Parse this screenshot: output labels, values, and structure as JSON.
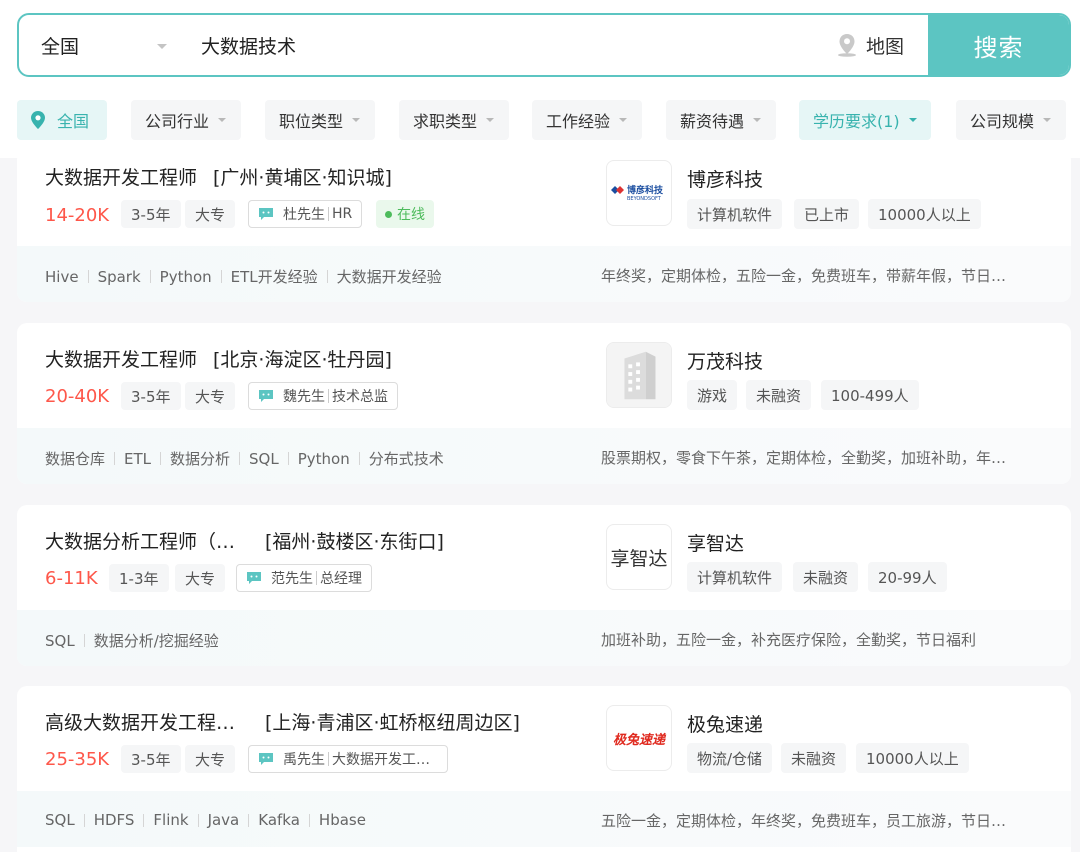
{
  "search": {
    "city": "全国",
    "query": "大数据技术",
    "map_label": "地图",
    "button_label": "搜索"
  },
  "filters": [
    {
      "label": "全国"
    },
    {
      "label": "公司行业"
    },
    {
      "label": "职位类型"
    },
    {
      "label": "求职类型"
    },
    {
      "label": "工作经验"
    },
    {
      "label": "薪资待遇"
    },
    {
      "label": "学历要求(1)"
    },
    {
      "label": "公司规模"
    }
  ],
  "colors": {
    "accent": "#5cc5c2",
    "salary": "#fe574a",
    "online": "#4dbb5c"
  },
  "jobs": [
    {
      "title": "大数据开发工程师",
      "location": "[广州·黄埔区·知识城]",
      "salary": "14-20K",
      "experience": "3-5年",
      "education": "大专",
      "recruiter_name": "杜先生",
      "recruiter_title": "HR",
      "online": "在线",
      "company": "博彦科技",
      "company_tags": [
        "计算机软件",
        "已上市",
        "10000人以上"
      ],
      "skills": [
        "Hive",
        "Spark",
        "Python",
        "ETL开发经验",
        "大数据开发经验"
      ],
      "welfare": "年终奖，定期体检，五险一金，免费班车，带薪年假，节日…",
      "logo_text": "博彦科技",
      "logo_sub": "BEYONDSOFT"
    },
    {
      "title": "大数据开发工程师",
      "location": "[北京·海淀区·牡丹园]",
      "salary": "20-40K",
      "experience": "3-5年",
      "education": "大专",
      "recruiter_name": "魏先生",
      "recruiter_title": "技术总监",
      "company": "万茂科技",
      "company_tags": [
        "游戏",
        "未融资",
        "100-499人"
      ],
      "skills": [
        "数据仓库",
        "ETL",
        "数据分析",
        "SQL",
        "Python",
        "分布式技术"
      ],
      "welfare": "股票期权，零食下午茶，定期体检，全勤奖，加班补助，年…"
    },
    {
      "title": "大数据分析工程师（…",
      "location": "[福州·鼓楼区·东街口]",
      "salary": "6-11K",
      "experience": "1-3年",
      "education": "大专",
      "recruiter_name": "范先生",
      "recruiter_title": "总经理",
      "company": "享智达",
      "company_tags": [
        "计算机软件",
        "未融资",
        "20-99人"
      ],
      "skills": [
        "SQL",
        "数据分析/挖掘经验"
      ],
      "welfare": "加班补助，五险一金，补充医疗保险，全勤奖，节日福利",
      "logo_text": "享智达"
    },
    {
      "title": "高级大数据开发工程…",
      "location": "[上海·青浦区·虹桥枢纽周边区]",
      "salary": "25-35K",
      "experience": "3-5年",
      "education": "大专",
      "recruiter_name": "禹先生",
      "recruiter_title": "大数据开发工…",
      "company": "极兔速递",
      "company_tags": [
        "物流/仓储",
        "未融资",
        "10000人以上"
      ],
      "skills": [
        "SQL",
        "HDFS",
        "Flink",
        "Java",
        "Kafka",
        "Hbase"
      ],
      "welfare": "五险一金，定期体检，年终奖，免费班车，员工旅游，节日…",
      "logo_text": "极兔速递"
    }
  ]
}
